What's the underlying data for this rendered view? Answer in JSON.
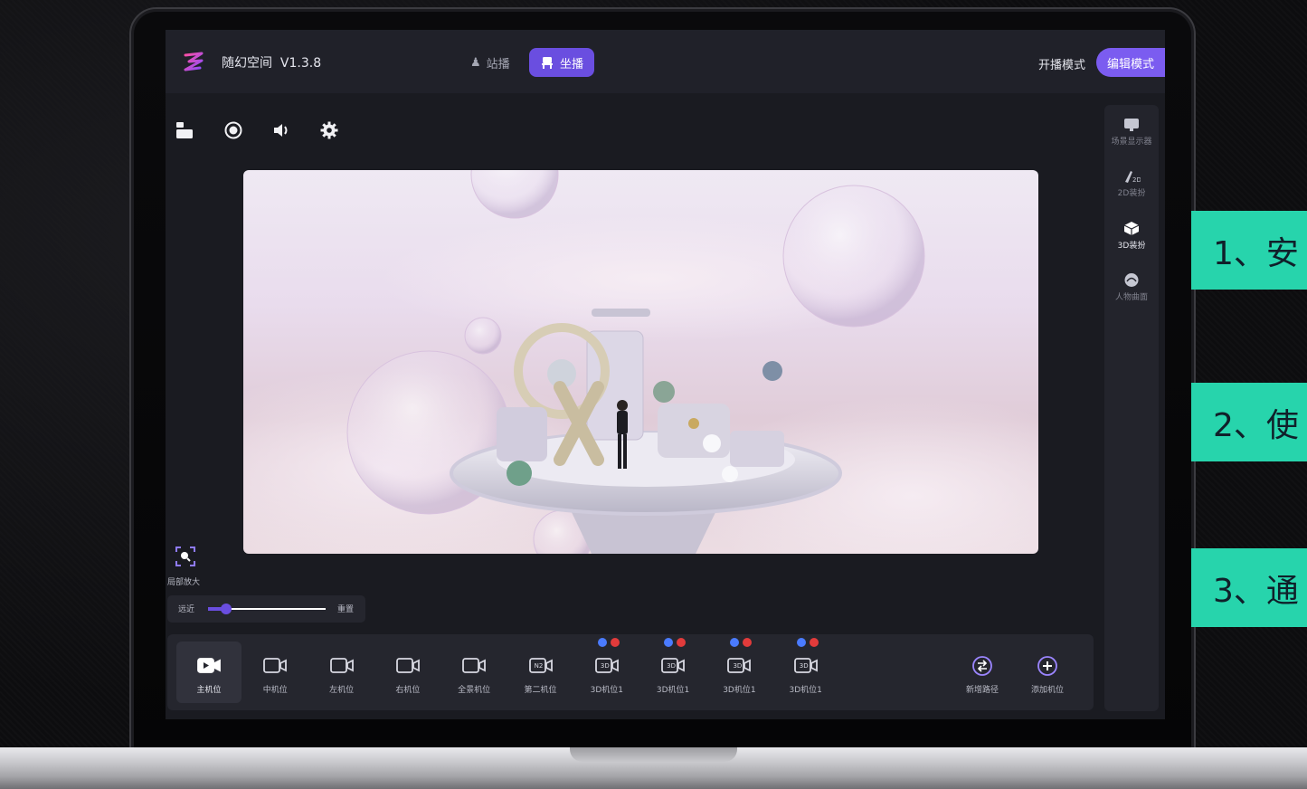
{
  "app": {
    "title": "随幻空间  V1.3.8"
  },
  "mode_tabs": [
    {
      "label": "站播",
      "active": false
    },
    {
      "label": "坐播",
      "active": true
    }
  ],
  "header_modes": {
    "live": "开播模式",
    "edit": "编辑模式"
  },
  "toolbar_icons": [
    "layout-icon",
    "record-icon",
    "volume-icon",
    "settings-icon"
  ],
  "right_panel": [
    {
      "label": "场景显示器",
      "icon": "monitor-icon",
      "active": false
    },
    {
      "label": "2D装扮",
      "icon": "brush-2d-icon",
      "active": false
    },
    {
      "label": "3D装扮",
      "icon": "cube-icon",
      "active": true
    },
    {
      "label": "人物曲面",
      "icon": "person-curve-icon",
      "active": false
    }
  ],
  "zoom": {
    "label": "局部放大",
    "near_far": "远近",
    "reset": "重置",
    "level": 0.15
  },
  "cameras": [
    {
      "label": "主机位",
      "active": true,
      "has_controls": false,
      "badge": ""
    },
    {
      "label": "中机位",
      "active": false,
      "has_controls": false,
      "badge": ""
    },
    {
      "label": "左机位",
      "active": false,
      "has_controls": false,
      "badge": ""
    },
    {
      "label": "右机位",
      "active": false,
      "has_controls": false,
      "badge": ""
    },
    {
      "label": "全景机位",
      "active": false,
      "has_controls": false,
      "badge": ""
    },
    {
      "label": "第二机位",
      "active": false,
      "has_controls": false,
      "badge": "N2"
    },
    {
      "label": "3D机位1",
      "active": false,
      "has_controls": true,
      "badge": "3D"
    },
    {
      "label": "3D机位1",
      "active": false,
      "has_controls": true,
      "badge": "3D"
    },
    {
      "label": "3D机位1",
      "active": false,
      "has_controls": true,
      "badge": "3D"
    },
    {
      "label": "3D机位1",
      "active": false,
      "has_controls": true,
      "badge": "3D"
    }
  ],
  "path_actions": [
    {
      "label": "新增路径",
      "icon": "path-icon"
    },
    {
      "label": "添加机位",
      "icon": "add-icon"
    }
  ],
  "side_banners": [
    "1、安",
    "2、使",
    "3、通"
  ],
  "colors": {
    "accent": "#6a4ee0",
    "banner": "#27d4ac",
    "edit_pill": "#7b5cf0"
  }
}
